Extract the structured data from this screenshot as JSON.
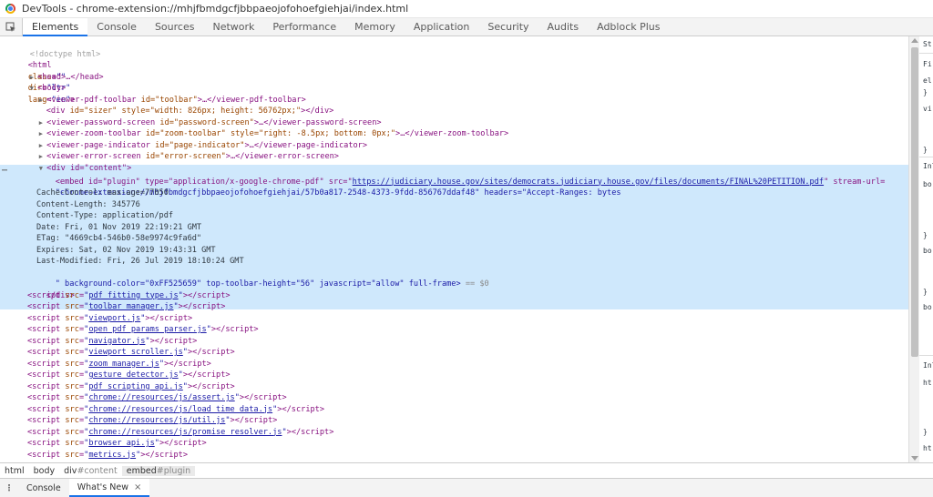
{
  "window": {
    "title": "DevTools - chrome-extension://mhjfbmdgcfjbbpaeojofohoefgiehjai/index.html"
  },
  "tabs": [
    "Elements",
    "Console",
    "Sources",
    "Network",
    "Performance",
    "Memory",
    "Application",
    "Security",
    "Audits",
    "Adblock Plus"
  ],
  "dom": {
    "doctype": "<!doctype html>",
    "html_tag": "html",
    "html_attrs": [
      {
        "name": "class",
        "value": "\"\""
      },
      {
        "name": "dir",
        "value": "\"ltr\""
      },
      {
        "name": "lang",
        "value": "\"en\""
      }
    ],
    "head": "<head>…</head>",
    "body_open": "<body>",
    "body_children": [
      {
        "tag": "viewer-pdf-toolbar",
        "attrs": "id=\"toolbar\"",
        "close": "…</viewer-pdf-toolbar>"
      },
      {
        "tag": "div",
        "attrs": "id=\"sizer\" style=\"width: 826px; height: 56762px;\"",
        "close": "></div>"
      },
      {
        "tag": "viewer-password-screen",
        "attrs": "id=\"password-screen\"",
        "close": "…</viewer-password-screen>"
      },
      {
        "tag": "viewer-zoom-toolbar",
        "attrs": "id=\"zoom-toolbar\" style=\"right: -8.5px; bottom: 0px;\"",
        "close": "…</viewer-zoom-toolbar>"
      },
      {
        "tag": "viewer-page-indicator",
        "attrs": "id=\"page-indicator\"",
        "close": "…</viewer-page-indicator>"
      },
      {
        "tag": "viewer-error-screen",
        "attrs": "id=\"error-screen\"",
        "close": "…</viewer-error-screen>"
      }
    ],
    "content_div": "<div id=\"content\">",
    "embed": {
      "line1_pre": "<embed id=\"plugin\" type=\"application/x-google-chrome-pdf\" src=\"",
      "src": "https://judiciary.house.gov/sites/democrats.judiciary.house.gov/files/documents/FINAL%20PETITION.pdf",
      "line1_post": "\" stream-url=",
      "line2": "\"chrome-extension://mhjfbmdgcfjbbpaeojofohoefgiehjai/57b0a817-2548-4373-9fdd-856767ddaf48\" headers=\"Accept-Ranges: bytes",
      "headers": [
        "Cache-Control: max-age=77050",
        "Content-Length: 345776",
        "Content-Type: application/pdf",
        "Date: Fri, 01 Nov 2019 22:19:21 GMT",
        "ETag: \"4669cb4-546b0-58e9974c9fa6d\"",
        "Expires: Sat, 02 Nov 2019 19:43:31 GMT",
        "Last-Modified: Fri, 26 Jul 2019 18:10:24 GMT"
      ],
      "last_line": "\" background-color=\"0xFF525659\" top-toolbar-height=\"56\" javascript=\"allow\" full-frame>",
      "eq": "== $0"
    },
    "div_close": "</div>",
    "scripts": [
      "pdf_fitting_type.js",
      "toolbar_manager.js",
      "viewport.js",
      "open_pdf_params_parser.js",
      "navigator.js",
      "viewport_scroller.js",
      "zoom_manager.js",
      "gesture_detector.js",
      "pdf_scripting_api.js",
      "chrome://resources/js/assert.js",
      "chrome://resources/js/load_time_data.js",
      "chrome://resources/js/util.js",
      "chrome://resources/js/promise_resolver.js",
      "browser_api.js",
      "metrics.js"
    ]
  },
  "side_panel": {
    "lines": [
      "St",
      "Fi",
      "el",
      "}",
      "vi",
      "}",
      "Inl",
      "bo",
      "}",
      "bo",
      "}",
      "bo",
      "Inl",
      "ht",
      "}",
      "ht"
    ]
  },
  "breadcrumbs": [
    {
      "tag": "html",
      "suffix": ""
    },
    {
      "tag": "body",
      "suffix": ""
    },
    {
      "tag": "div",
      "suffix": "#content"
    },
    {
      "tag": "embed",
      "suffix": "#plugin"
    }
  ],
  "drawer": {
    "tabs": [
      {
        "label": "Console",
        "closable": false
      },
      {
        "label": "What's New",
        "closable": true
      }
    ],
    "close_glyph": "×"
  }
}
